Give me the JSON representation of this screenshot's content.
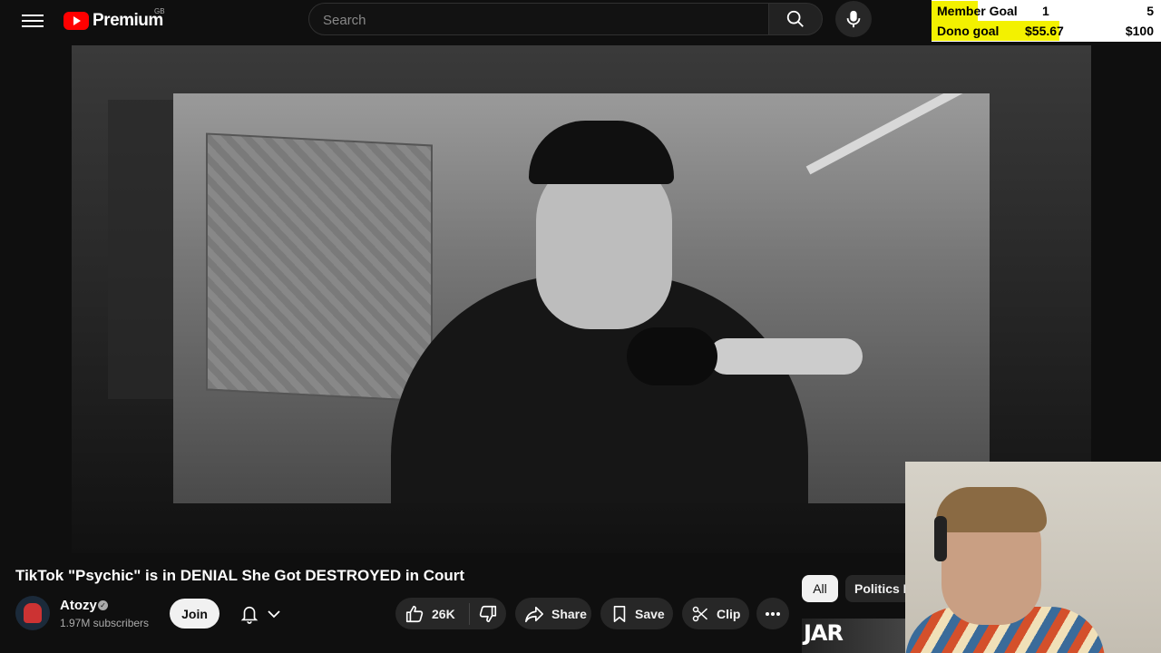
{
  "header": {
    "logo_text": "Premium",
    "logo_region": "GB",
    "search_placeholder": "Search"
  },
  "stream_overlay": {
    "member_goal": {
      "label": "Member Goal",
      "current": "1",
      "target": "5",
      "progress": 0.2
    },
    "dono_goal": {
      "label": "Dono goal",
      "current": "$55.67",
      "target": "$100",
      "progress": 0.5567
    },
    "highlight_color": "#f3f100"
  },
  "video": {
    "title": "TikTok \"Psychic\" is in DENIAL She Got DESTROYED in Court"
  },
  "channel": {
    "name": "Atozy",
    "subscribers": "1.97M subscribers",
    "join_label": "Join"
  },
  "actions": {
    "like_count": "26K",
    "share_label": "Share",
    "save_label": "Save",
    "clip_label": "Clip"
  },
  "chips": {
    "all_label": "All",
    "politics_label": "Politics N"
  },
  "next_thumbnail": {
    "text": "JAR"
  },
  "icons": {
    "menu": "hamburger-icon",
    "search": "search-icon",
    "mic": "microphone-icon",
    "verified": "verified-check-icon",
    "bell": "bell-icon",
    "like": "thumbs-up-icon",
    "dislike": "thumbs-down-icon",
    "share": "share-arrow-icon",
    "save": "bookmark-icon",
    "clip": "scissors-icon",
    "more": "more-horizontal-icon"
  }
}
